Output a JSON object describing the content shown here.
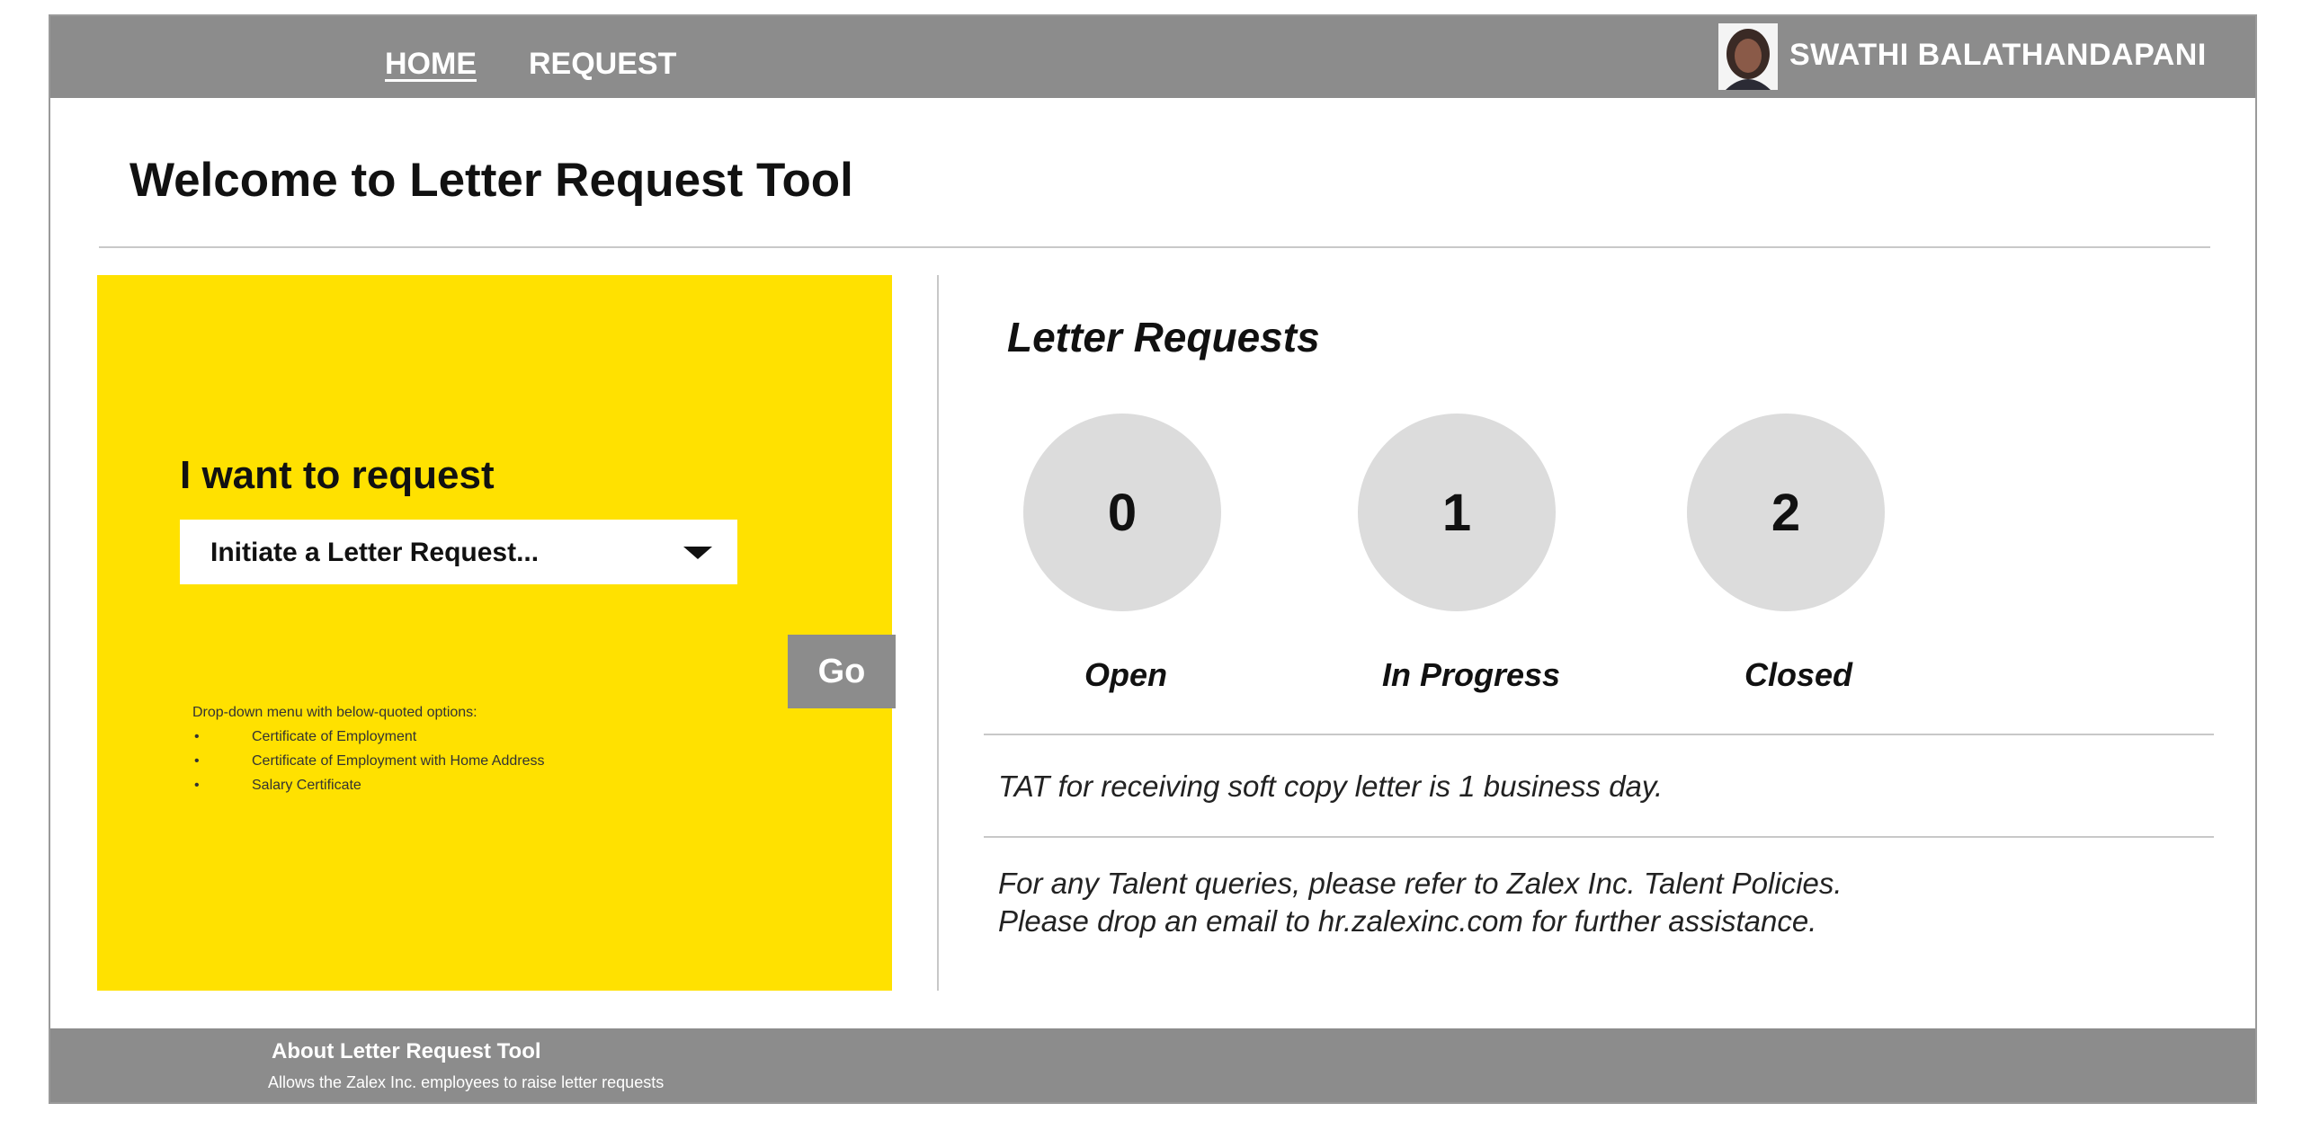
{
  "nav": {
    "home_label": "HOME",
    "request_label": "REQUEST",
    "user_name": "SWATHI BALATHANDAPANI"
  },
  "page": {
    "title": "Welcome to Letter Request Tool"
  },
  "request_panel": {
    "heading": "I want to request",
    "select_value": "Initiate a Letter Request...",
    "go_label": "Go",
    "note": "Drop-down menu with below-quoted options:",
    "options": [
      "Certificate of Employment",
      "Certificate of Employment with Home Address",
      "Salary Certificate"
    ]
  },
  "letter_requests": {
    "title": "Letter Requests",
    "stats": [
      {
        "count": "0",
        "label": "Open"
      },
      {
        "count": "1",
        "label": "In Progress"
      },
      {
        "count": "2",
        "label": "Closed"
      }
    ],
    "tat_text": "TAT for receiving soft copy letter is 1 business day.",
    "contact_line1": "For any Talent queries, please refer to Zalex Inc. Talent Policies.",
    "contact_line2": "Please drop an email to hr.zalexinc.com for further assistance."
  },
  "footer": {
    "title": "About Letter Request Tool",
    "subtitle": "Allows the Zalex Inc. employees to raise letter requests"
  },
  "colors": {
    "nav_bg": "#8c8c8c",
    "panel_yellow": "#ffe100",
    "circle_gray": "#dcdcdc"
  }
}
